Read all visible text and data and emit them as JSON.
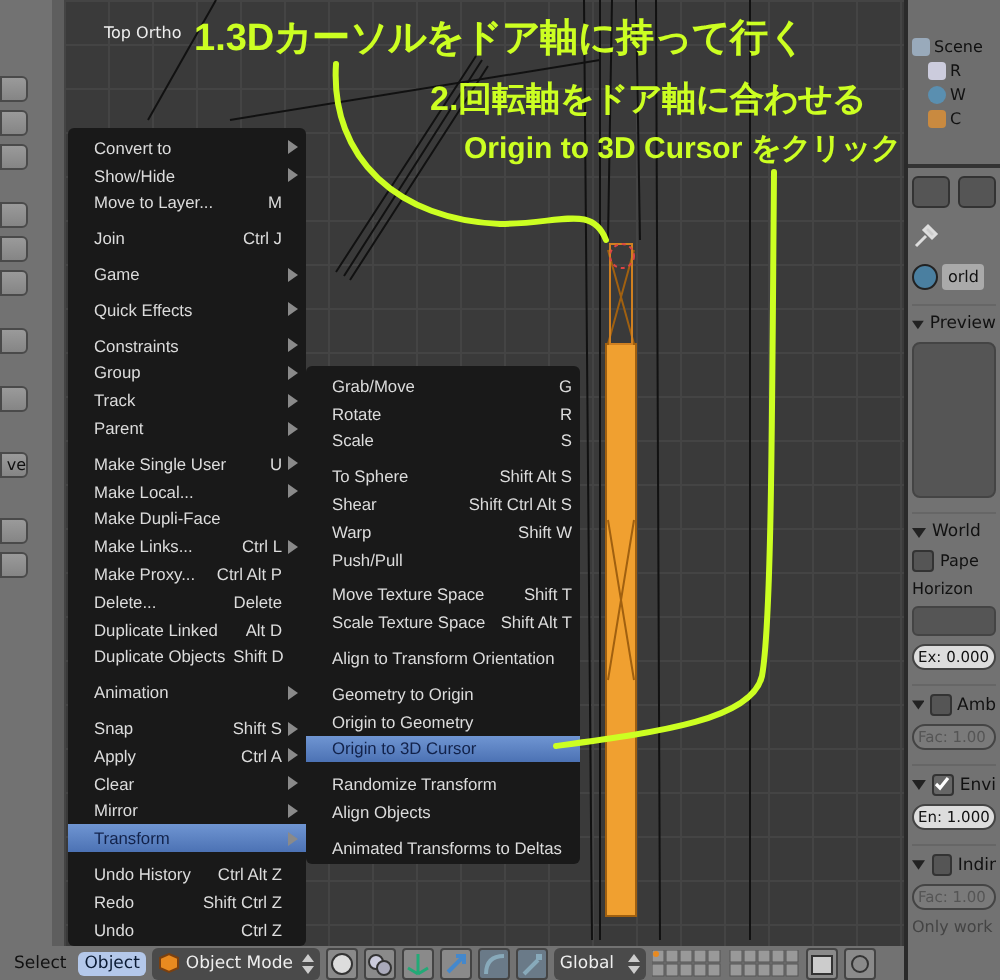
{
  "viewport": {
    "label": "Top Ortho"
  },
  "annotations": [
    "1.3Dカーソルをドア軸に持って行く",
    "2.回転軸をドア軸に合わせる",
    "Origin to 3D Cursor をクリック"
  ],
  "toolbar": {
    "cut_label": "ve"
  },
  "object_menu": {
    "groups": [
      [
        {
          "label": "Convert to",
          "submenu": true,
          "selected": false
        },
        {
          "label": "Show/Hide",
          "submenu": true,
          "selected": false
        },
        {
          "label": "Move to Layer...",
          "shortcut": "M",
          "submenu": false,
          "selected": false
        }
      ],
      [
        {
          "label": "Join",
          "shortcut": "Ctrl J",
          "submenu": false,
          "selected": false
        }
      ],
      [
        {
          "label": "Game",
          "submenu": true,
          "selected": false
        }
      ],
      [
        {
          "label": "Quick Effects",
          "submenu": true,
          "selected": false
        }
      ],
      [
        {
          "label": "Constraints",
          "submenu": true,
          "selected": false
        },
        {
          "label": "Group",
          "submenu": true,
          "selected": false
        },
        {
          "label": "Track",
          "submenu": true,
          "selected": false
        },
        {
          "label": "Parent",
          "submenu": true,
          "selected": false
        }
      ],
      [
        {
          "label": "Make Single User",
          "shortcut": "U",
          "submenu": true,
          "selected": false
        },
        {
          "label": "Make Local...",
          "submenu": true,
          "selected": false
        },
        {
          "label": "Make Dupli-Face",
          "submenu": false,
          "selected": false
        },
        {
          "label": "Make Links...",
          "shortcut": "Ctrl L",
          "submenu": true,
          "selected": false
        },
        {
          "label": "Make Proxy...",
          "shortcut": "Ctrl Alt P",
          "submenu": false,
          "selected": false
        },
        {
          "label": "Delete...",
          "shortcut": "Delete",
          "submenu": false,
          "selected": false
        },
        {
          "label": "Duplicate Linked",
          "shortcut": "Alt D",
          "submenu": false,
          "selected": false
        },
        {
          "label": "Duplicate Objects",
          "shortcut": "Shift D",
          "submenu": false,
          "selected": false
        }
      ],
      [
        {
          "label": "Animation",
          "submenu": true,
          "selected": false
        }
      ],
      [
        {
          "label": "Snap",
          "shortcut": "Shift S",
          "submenu": true,
          "selected": false
        },
        {
          "label": "Apply",
          "shortcut": "Ctrl A",
          "submenu": true,
          "selected": false
        },
        {
          "label": "Clear",
          "submenu": true,
          "selected": false
        },
        {
          "label": "Mirror",
          "submenu": true,
          "selected": false
        },
        {
          "label": "Transform",
          "submenu": true,
          "selected": true
        }
      ],
      [
        {
          "label": "Undo History",
          "shortcut": "Ctrl Alt Z",
          "submenu": false,
          "selected": false
        },
        {
          "label": "Redo",
          "shortcut": "Shift Ctrl Z",
          "submenu": false,
          "selected": false
        },
        {
          "label": "Undo",
          "shortcut": "Ctrl Z",
          "submenu": false,
          "selected": false
        }
      ]
    ]
  },
  "transform_menu": {
    "groups": [
      [
        {
          "label": "Grab/Move",
          "shortcut": "G",
          "selected": false
        },
        {
          "label": "Rotate",
          "shortcut": "R",
          "selected": false
        },
        {
          "label": "Scale",
          "shortcut": "S",
          "selected": false
        }
      ],
      [
        {
          "label": "To Sphere",
          "shortcut": "Shift Alt S",
          "selected": false
        },
        {
          "label": "Shear",
          "shortcut": "Shift Ctrl Alt S",
          "selected": false
        },
        {
          "label": "Warp",
          "shortcut": "Shift W",
          "selected": false
        },
        {
          "label": "Push/Pull",
          "selected": false
        }
      ],
      [
        {
          "label": "Move Texture Space",
          "shortcut": "Shift T",
          "selected": false
        },
        {
          "label": "Scale Texture Space",
          "shortcut": "Shift Alt T",
          "selected": false
        }
      ],
      [
        {
          "label": "Align to Transform Orientation",
          "selected": false
        }
      ],
      [
        {
          "label": "Geometry to Origin",
          "selected": false
        },
        {
          "label": "Origin to Geometry",
          "selected": false
        },
        {
          "label": "Origin to 3D Cursor",
          "selected": true
        }
      ],
      [
        {
          "label": "Randomize Transform",
          "selected": false
        },
        {
          "label": "Align Objects",
          "selected": false
        }
      ],
      [
        {
          "label": "Animated Transforms to Deltas",
          "selected": false
        }
      ]
    ]
  },
  "bottom_bar": {
    "menus": [
      {
        "label": "Select",
        "selected": false
      },
      {
        "label": "Object",
        "selected": true
      }
    ],
    "mode": "Object Mode",
    "orientation": "Global"
  },
  "outliner": {
    "rows": [
      {
        "label": "Scene",
        "kind": "scene"
      },
      {
        "label": "R",
        "kind": "render"
      },
      {
        "label": "W",
        "kind": "world"
      },
      {
        "label": "C",
        "kind": "camera"
      }
    ]
  },
  "properties": {
    "datablock": "orld",
    "sections": [
      {
        "title": "Preview",
        "kind": "preview"
      },
      {
        "title": "World",
        "kind": "plain",
        "rows": [
          {
            "kind": "checkbox",
            "label": "Pape",
            "checked": false
          },
          {
            "kind": "label",
            "label": "Horizon"
          },
          {
            "kind": "swatch"
          },
          {
            "kind": "field",
            "label": "Ex: 0.000",
            "disabled": false
          }
        ]
      },
      {
        "title": "Amb",
        "kind": "toggle",
        "checked": false,
        "rows": [
          {
            "kind": "field",
            "label": "Fac: 1.00",
            "disabled": true
          }
        ]
      },
      {
        "title": "Envi",
        "kind": "toggle",
        "checked": true,
        "rows": [
          {
            "kind": "field",
            "label": "En: 1.000",
            "disabled": false
          }
        ]
      },
      {
        "title": "Indir",
        "kind": "toggle",
        "checked": false,
        "rows": [
          {
            "kind": "field",
            "label": "Fac: 1.00",
            "disabled": true
          },
          {
            "kind": "note",
            "label": "Only work"
          }
        ]
      }
    ]
  }
}
